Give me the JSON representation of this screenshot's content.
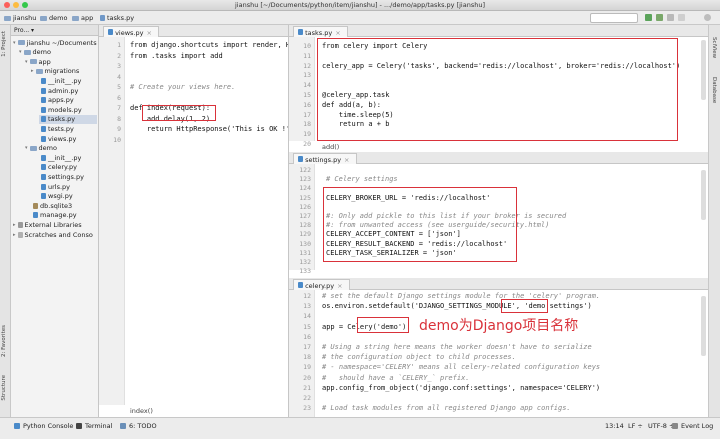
{
  "window": {
    "title": "jianshu [~/Documents/python/item/jianshu] - .../demo/app/tasks.py [jianshu]"
  },
  "breadcrumbs": [
    "jianshu",
    "demo",
    "app",
    "tasks.py"
  ],
  "side_strip": {
    "left": [
      "1: Project",
      "2: Favorites",
      "Structure"
    ],
    "right": [
      "SciView",
      "Database"
    ]
  },
  "project": {
    "header": "Pro... ▾",
    "tree": [
      {
        "label": "jianshu ~/Documents",
        "icon": "folder-icon",
        "caret": "▾"
      },
      {
        "label": "demo",
        "icon": "folder-icon",
        "caret": "▾"
      },
      {
        "label": "app",
        "icon": "folder-icon",
        "caret": "▾"
      },
      {
        "label": "migrations",
        "icon": "folder-icon",
        "caret": "▸"
      },
      {
        "label": "__init__.py",
        "icon": "python-file-icon",
        "caret": ""
      },
      {
        "label": "admin.py",
        "icon": "python-file-icon",
        "caret": ""
      },
      {
        "label": "apps.py",
        "icon": "python-file-icon",
        "caret": ""
      },
      {
        "label": "models.py",
        "icon": "python-file-icon",
        "caret": ""
      },
      {
        "label": "tasks.py",
        "icon": "python-file-icon",
        "caret": "",
        "selected": true
      },
      {
        "label": "tests.py",
        "icon": "python-file-icon",
        "caret": ""
      },
      {
        "label": "views.py",
        "icon": "python-file-icon",
        "caret": ""
      },
      {
        "label": "demo",
        "icon": "folder-icon",
        "caret": "▾"
      },
      {
        "label": "__init__.py",
        "icon": "python-file-icon",
        "caret": ""
      },
      {
        "label": "celery.py",
        "icon": "python-file-icon",
        "caret": ""
      },
      {
        "label": "settings.py",
        "icon": "python-file-icon",
        "caret": ""
      },
      {
        "label": "urls.py",
        "icon": "python-file-icon",
        "caret": ""
      },
      {
        "label": "wsgi.py",
        "icon": "python-file-icon",
        "caret": ""
      },
      {
        "label": "db.sqlite3",
        "icon": "database-icon",
        "caret": ""
      },
      {
        "label": "manage.py",
        "icon": "python-file-icon",
        "caret": ""
      },
      {
        "label": "External Libraries",
        "icon": "library-icon",
        "caret": "▸"
      },
      {
        "label": "Scratches and Conso",
        "icon": "scratch-icon",
        "caret": "▸"
      }
    ]
  },
  "views_editor": {
    "tab": "views.py",
    "line_numbers": [
      "1",
      "2",
      "3",
      "4",
      "5",
      "6",
      "7",
      "8",
      "9",
      "10"
    ],
    "lines": [
      "from django.shortcuts import render, H",
      "from .tasks import add",
      "",
      "",
      "# Create your views here.",
      "",
      "def index(request):",
      "    add.delay(1, 2)",
      "    return HttpResponse('This is OK !')",
      ""
    ],
    "breadcrumb": "index()"
  },
  "tasks_editor": {
    "tab": "tasks.py",
    "line_numbers": [
      "10",
      "11",
      "12",
      "13",
      "14",
      "15",
      "16",
      "17",
      "18",
      "19",
      "20"
    ],
    "lines": [
      "from celery import Celery",
      "",
      "celery_app = Celery('tasks', backend='redis://localhost', broker='redis://localhost')",
      "",
      "",
      "@celery_app.task",
      "def add(a, b):",
      "    time.sleep(5)",
      "    return a + b",
      "",
      ""
    ],
    "breadcrumb": "add()"
  },
  "settings_editor": {
    "tab": "settings.py",
    "line_numbers": [
      "122",
      "123",
      "124",
      "125",
      "126",
      "127",
      "128",
      "129",
      "130",
      "131",
      "132",
      "133"
    ],
    "lines": [
      "",
      "# Celery settings",
      "",
      "CELERY_BROKER_URL = 'redis://localhost'",
      "",
      "#: Only add pickle to this list if your broker is secured",
      "#: from unwanted access (see userguide/security.html)",
      "CELERY_ACCEPT_CONTENT = ['json']",
      "CELERY_RESULT_BACKEND = 'redis://localhost'",
      "CELERY_TASK_SERIALIZER = 'json'",
      "",
      ""
    ]
  },
  "celery_editor": {
    "tab": "celery.py",
    "line_numbers": [
      "12",
      "13",
      "14",
      "15",
      "16",
      "17",
      "18",
      "19",
      "20",
      "21",
      "22",
      "23"
    ],
    "lines": [
      "# set the default Django settings module for the 'celery' program.",
      "os.environ.setdefault('DJANGO_SETTINGS_MODULE', 'demo.settings')",
      "",
      "app = Celery('demo')",
      "",
      "# Using a string here means the worker doesn't have to serialize",
      "# the configuration object to child processes.",
      "# - namespace='CELERY' means all celery-related configuration keys",
      "#   should have a `CELERY_` prefix.",
      "app.config_from_object('django.conf:settings', namespace='CELERY')",
      "",
      "# Load task modules from all registered Django app configs."
    ]
  },
  "annotation": "demo为Django项目名称",
  "statusbar": {
    "items": [
      "Python Console",
      "Terminal",
      "6: TODO"
    ],
    "right": [
      "13:14",
      "LF ÷",
      "UTF-8 ÷"
    ],
    "event_log": "Event Log"
  },
  "colors": {
    "highlight_box": "#d9323a",
    "selection": "#cfd8e6"
  }
}
